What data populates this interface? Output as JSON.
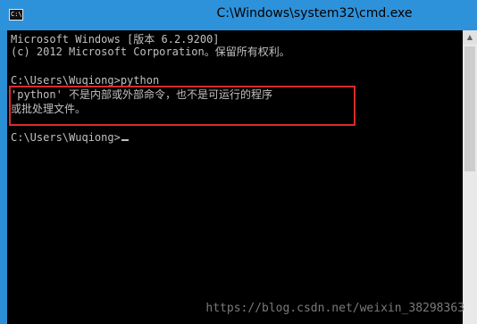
{
  "window": {
    "title": "C:\\Windows\\system32\\cmd.exe",
    "icon": "command-prompt-icon",
    "icon_text": "C:\\"
  },
  "console": {
    "lines": [
      "Microsoft Windows [版本 6.2.9200]",
      "(c) 2012 Microsoft Corporation。保留所有权利。",
      "",
      "C:\\Users\\Wuqiong>python",
      "'python' 不是内部或外部命令，也不是可运行的程序",
      "或批处理文件。",
      "",
      "C:\\Users\\Wuqiong>"
    ]
  },
  "annotation": {
    "highlight_color": "#d62d2d"
  },
  "watermark": "https://blog.csdn.net/weixin_38298363",
  "colors": {
    "title_bar": "#2e92da",
    "console_bg": "#000000",
    "console_text": "#c0c0c0"
  }
}
